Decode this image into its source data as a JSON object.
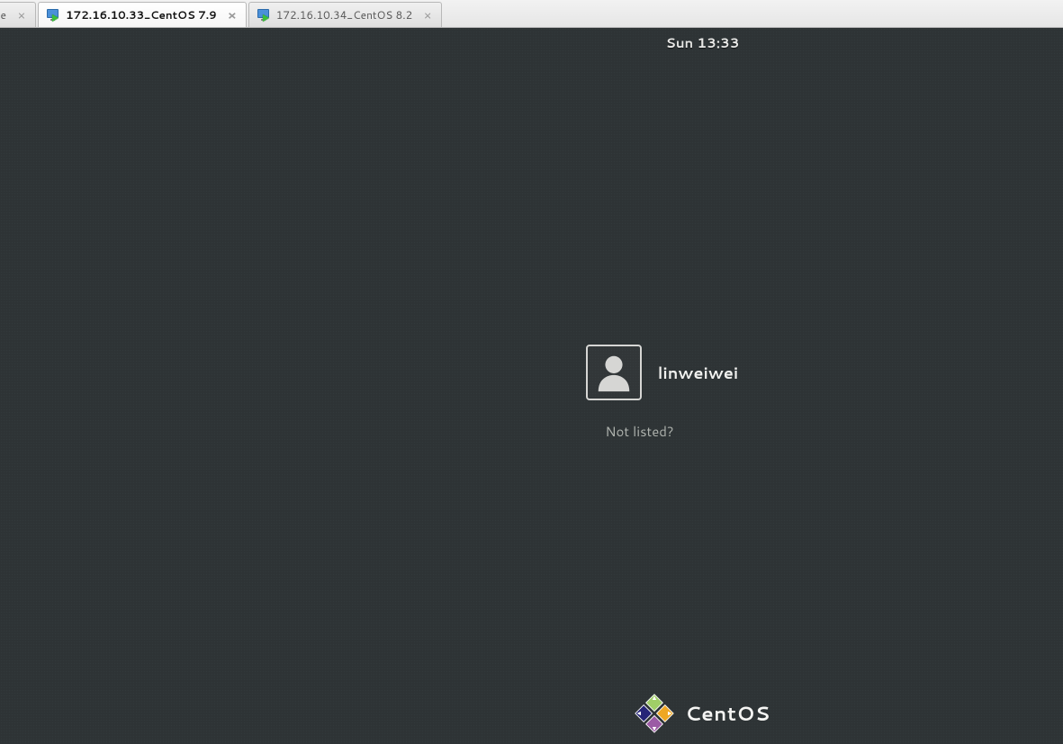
{
  "tabs": {
    "partial": {
      "label_fragment": "e"
    },
    "items": [
      {
        "label": "172.16.10.33_CentOS 7.9",
        "active": true
      },
      {
        "label": "172.16.10.34_CentOS 8.2",
        "active": false
      }
    ]
  },
  "topbar": {
    "clock": "Sun 13:33"
  },
  "login": {
    "users": [
      {
        "name": "linweiwei"
      }
    ],
    "not_listed_label": "Not listed?"
  },
  "branding": {
    "distro": "CentOS"
  },
  "colors": {
    "desktop_bg": "#2e3436",
    "text_primary": "#eeeeec",
    "text_muted": "#aeb2ad",
    "centos_purple": "#9b5ba5",
    "centos_green": "#a0ce67",
    "centos_orange": "#efa724",
    "centos_blue": "#262577"
  }
}
